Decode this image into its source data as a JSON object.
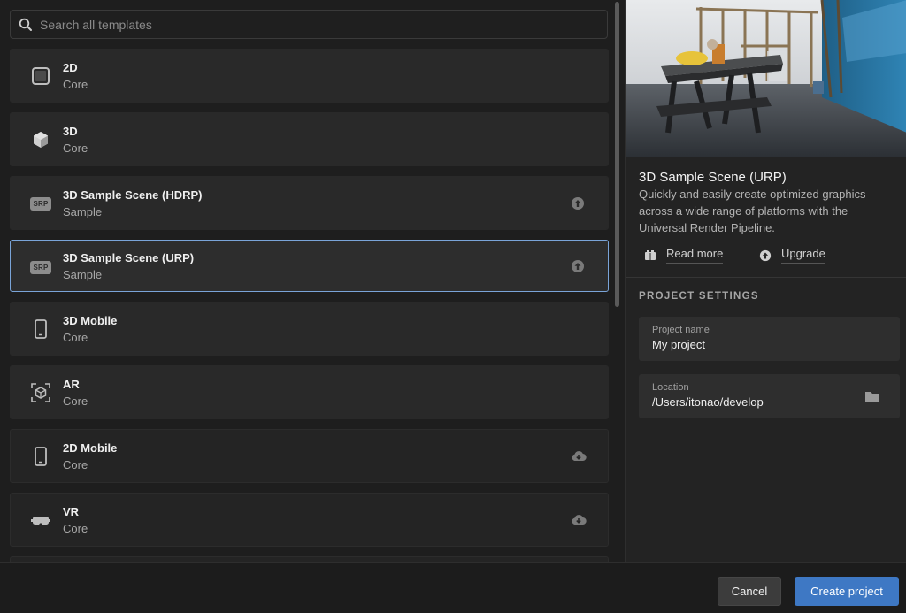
{
  "search": {
    "placeholder": "Search all templates",
    "icon": "search-icon"
  },
  "templates": [
    {
      "title": "2D",
      "category": "Core",
      "icon": "square-icon",
      "action": ""
    },
    {
      "title": "3D",
      "category": "Core",
      "icon": "cube-icon",
      "action": ""
    },
    {
      "title": "3D Sample Scene (HDRP)",
      "category": "Sample",
      "icon": "srp-icon",
      "icon_text": "SRP",
      "action": "upgrade-arrow-icon"
    },
    {
      "title": "3D Sample Scene (URP)",
      "category": "Sample",
      "icon": "srp-icon",
      "icon_text": "SRP",
      "action": "upgrade-arrow-icon",
      "selected": true
    },
    {
      "title": "3D Mobile",
      "category": "Core",
      "icon": "phone-icon",
      "action": ""
    },
    {
      "title": "AR",
      "category": "Core",
      "icon": "ar-cube-icon",
      "action": ""
    },
    {
      "title": "2D Mobile",
      "category": "Core",
      "icon": "phone-icon",
      "action": "cloud-download-icon"
    },
    {
      "title": "VR",
      "category": "Core",
      "icon": "vr-headset-icon",
      "action": "cloud-download-icon"
    }
  ],
  "details": {
    "title": "3D Sample Scene (URP)",
    "description": "Quickly and easily create optimized graphics across a wide range of platforms with the Universal Render Pipeline.",
    "read_more": "Read more",
    "upgrade": "Upgrade"
  },
  "settings": {
    "section_title": "PROJECT SETTINGS",
    "project_name_label": "Project name",
    "project_name_value": "My project",
    "location_label": "Location",
    "location_value": "/Users/itonao/develop"
  },
  "footer": {
    "cancel": "Cancel",
    "create": "Create project"
  },
  "colors": {
    "accent": "#3e78c4",
    "selected_border": "#7aa4d8",
    "panel": "#292929"
  }
}
